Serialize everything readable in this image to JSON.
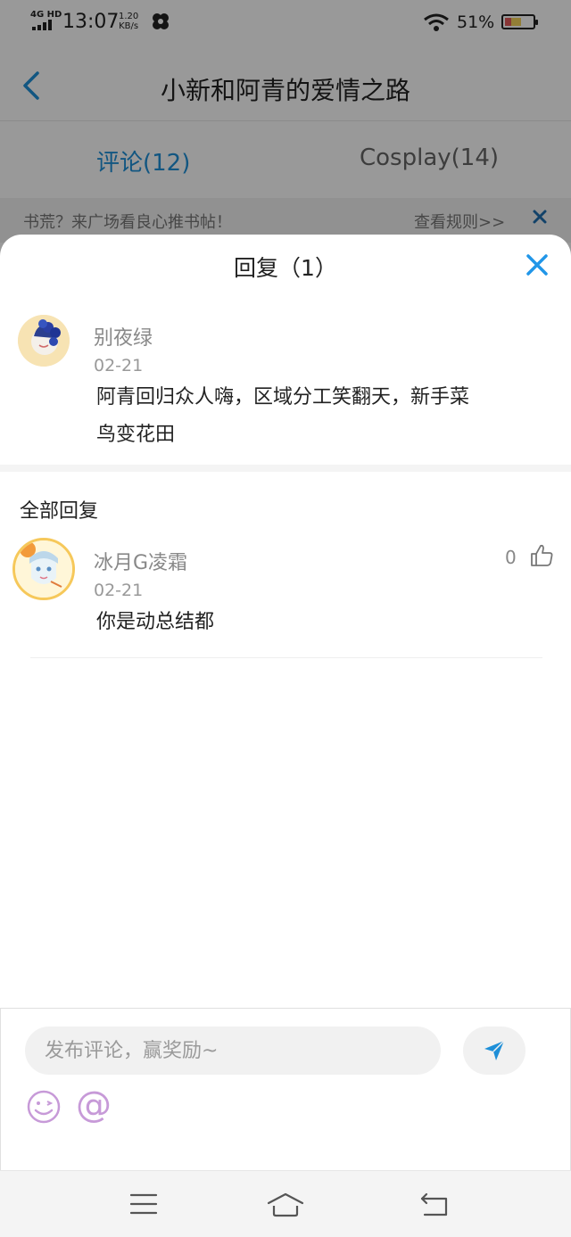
{
  "status_bar": {
    "network": "4G HD",
    "time": "13:07",
    "speed_value": "1.20",
    "speed_unit": "KB/s",
    "battery_percent": "51%"
  },
  "nav": {
    "title": "小新和阿青的爱情之路"
  },
  "tabs": [
    {
      "label": "评论(12)",
      "active": true
    },
    {
      "label": "Cosplay(14)",
      "active": false
    }
  ],
  "notice": {
    "text": "书荒？来广场看良心推书帖！",
    "rules_link": "查看规则>>"
  },
  "reply_sheet": {
    "title": "回复（1）",
    "original": {
      "username": "别夜绿",
      "date": "02-21",
      "text_line1": "阿青回归众人嗨，区域分工笑翻天，新手菜",
      "text_line2": "鸟变花田"
    },
    "section_title": "全部回复",
    "replies": [
      {
        "username": "冰月G凌霜",
        "date": "02-21",
        "text": "你是动总结都",
        "likes": "0"
      }
    ]
  },
  "composer": {
    "placeholder": "发布评论，赢奖励~",
    "at_symbol": "@"
  },
  "colors": {
    "accent_blue": "#1e8fd8",
    "emoji_purple": "#c79ad8"
  }
}
